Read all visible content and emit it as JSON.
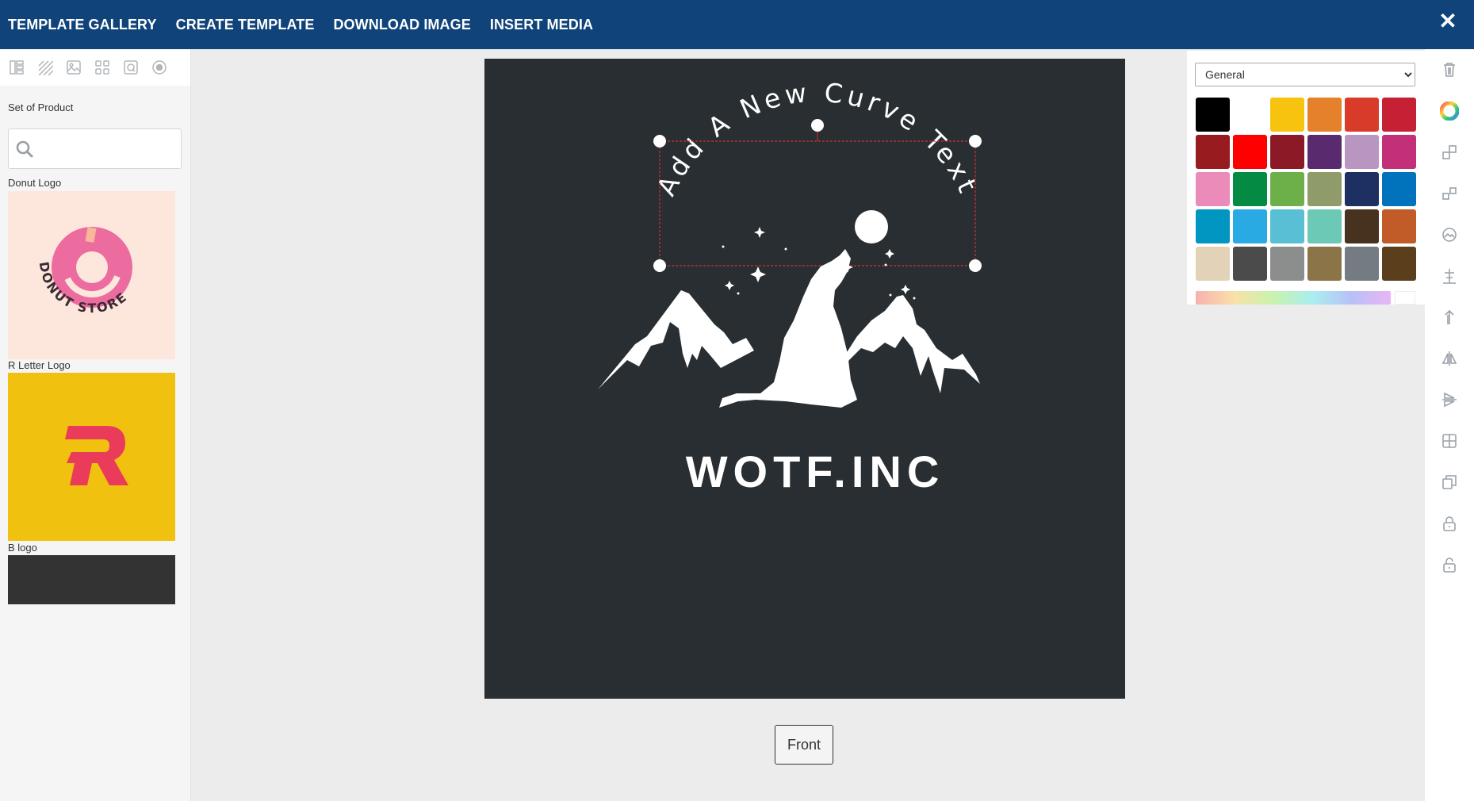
{
  "nav": {
    "items": [
      "TEMPLATE GALLERY",
      "CREATE TEMPLATE",
      "DOWNLOAD IMAGE",
      "INSERT MEDIA"
    ],
    "close_label": "✕"
  },
  "left_panel": {
    "section_label": "Set of Product",
    "search": {
      "value": "",
      "placeholder": ""
    },
    "templates": [
      {
        "title": "Donut Logo",
        "logo_text": "DONUT STORE",
        "bg": "#fde6dc"
      },
      {
        "title": "R Letter Logo",
        "logo_text": "R",
        "bg": "#f0c20f"
      },
      {
        "title": "B logo",
        "bg": "#333333"
      }
    ]
  },
  "design": {
    "curve_text": "Add A New Curve Text",
    "brand_text": "WOTF.INC",
    "background": "#282e31"
  },
  "side_label": "Front",
  "color_panel": {
    "dropdown_value": "General",
    "swatches": [
      "#000000",
      "#ffffff",
      "#f8c30f",
      "#e5812a",
      "#d93b2a",
      "#c62035",
      "#981b1f",
      "#ff0000",
      "#8c1a26",
      "#5a2a6e",
      "#b996c1",
      "#c2307a",
      "#ea8bba",
      "#058a44",
      "#6db04a",
      "#8f9b69",
      "#1e2f61",
      "#0173bd",
      "#0196c1",
      "#29aae3",
      "#58bfd4",
      "#6bc9b5",
      "#47321f",
      "#c15b27",
      "#e2d3b8",
      "#4b4b4b",
      "#8c8e8d",
      "#8c7449",
      "#747b83",
      "#5b3f1c"
    ]
  },
  "right_tools": [
    "trash-icon",
    "color-wheel-icon",
    "bring-forward-icon",
    "send-backward-icon",
    "image-filter-icon",
    "align-icon",
    "move-up-icon",
    "flip-horizontal-icon",
    "flip-vertical-icon",
    "grid-icon",
    "duplicate-icon",
    "lock-icon",
    "unlock-icon"
  ]
}
